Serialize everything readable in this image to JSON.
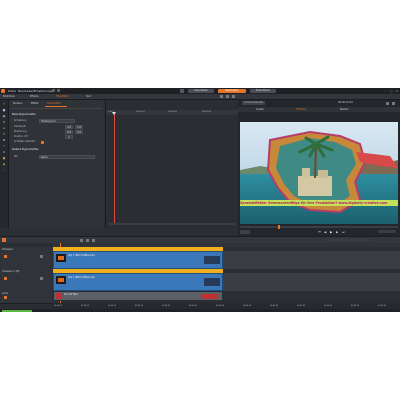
{
  "menu": {
    "items": [
      "Datei",
      "Bearbeiten",
      "Einstellungen"
    ],
    "center_tabs": [
      "Importieren",
      "Bearbeiten",
      "Exportieren"
    ],
    "active_tab_index": 1,
    "window_controls": [
      "–",
      "□",
      "✕"
    ]
  },
  "toolbar": {
    "items": [
      "Bibliothek",
      "Effekte",
      "Titel-Editor",
      "Text"
    ]
  },
  "settings": {
    "tabs": [
      "Medien",
      "Effekt",
      "Titel-Editor"
    ],
    "sections": {
      "basic": "Basis-Eigenschaften",
      "advanced": "Weitere Eigenschaften"
    },
    "fields": [
      {
        "label": "Schablone",
        "value": "Hintergrund"
      },
      {
        "label": "Deckkraft",
        "value": "100"
      },
      {
        "label": "Skalierung",
        "value": "100"
      },
      {
        "label": "Position X/Y",
        "value": "0"
      },
      {
        "label": "Schatten aktiviert",
        "value": ""
      }
    ],
    "extra": {
      "label": "Stil",
      "value": "Keine"
    }
  },
  "keyframes": {
    "ruler": [
      "0:00",
      "00:00:01",
      "00:00:02",
      "00:00:03"
    ]
  },
  "preview": {
    "header": "Vorschaufenster",
    "timecode": "00:00:12:04",
    "tabs": [
      "Quelle",
      "Timeline",
      "Medien"
    ],
    "active_tab_index": 1,
    "banner_text": "Spezialeffekte: Greenscreenflilge für Ihre Produktion?  www.digitally-creative.com"
  },
  "timeline": {
    "tracks": [
      {
        "name": "Videospur",
        "clip": "Clip 1 (MKV) 1080p.mp4"
      },
      {
        "name": "Videospur 2 (M)",
        "clip": "Clip 2 (MKV) 1080p.mp4"
      },
      {
        "name": "Audio",
        "clip": "Ton mit Titel"
      }
    ],
    "timecodes": [
      "00:00:00",
      "00:00:05",
      "00:00:10",
      "00:00:15",
      "00:00:20",
      "00:00:25",
      "00:00:30",
      "00:00:35",
      "00:00:40",
      "00:00:45",
      "00:00:50",
      "00:00:55",
      "00:01:00"
    ]
  },
  "colors": {
    "accent": "#e8732a",
    "clip": "#3a78b9",
    "clip_header": "#f2b01c"
  }
}
